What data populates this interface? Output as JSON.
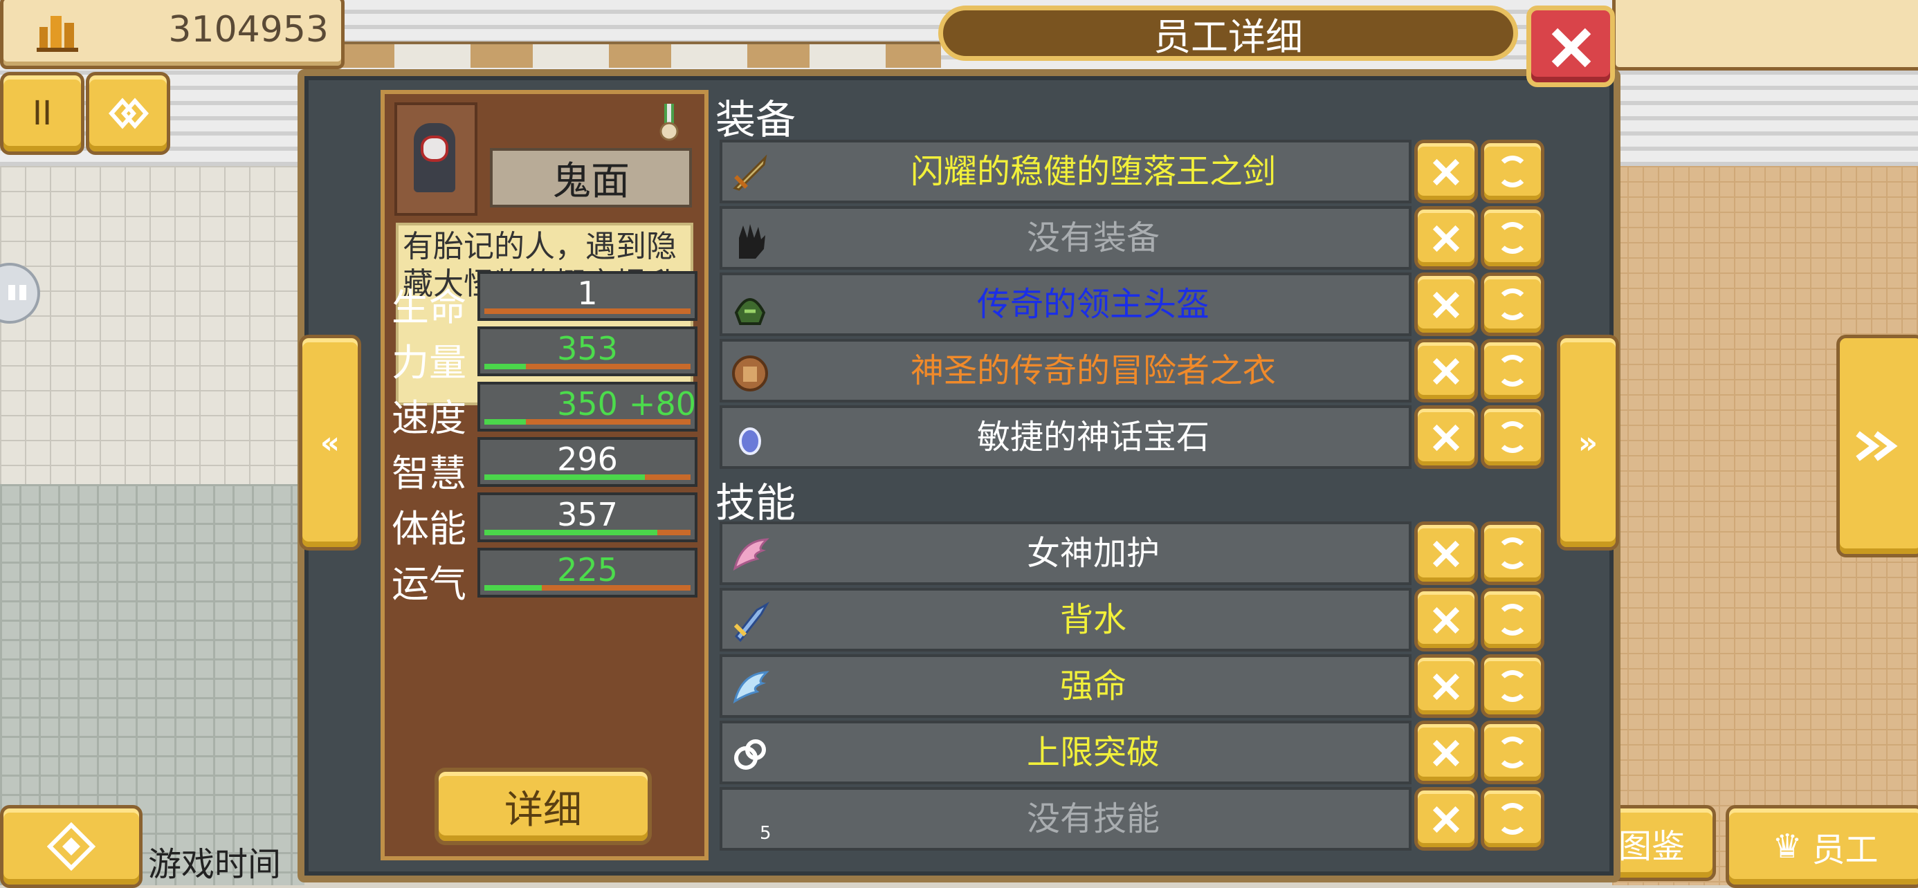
{
  "hud": {
    "money": "3104953",
    "pause_label": "II",
    "time_label": "游戏时间",
    "codex_label": "图鉴",
    "staff_label": "员工"
  },
  "dialog": {
    "title": "员工详细",
    "prev_arrow": "«",
    "next_arrow": "»"
  },
  "employee": {
    "name": "鬼面",
    "description": "有胎记的人，遇到隐藏大怪物的概率提升",
    "detail_button": "详细",
    "stats": [
      {
        "label": "生命",
        "value": "1",
        "bonus": "",
        "fill": 0.0,
        "color": "#ffffff"
      },
      {
        "label": "力量",
        "value": "353",
        "bonus": "",
        "fill": 0.2,
        "color": "#4cdc4c"
      },
      {
        "label": "速度",
        "value": "350",
        "bonus": "+80",
        "fill": 0.2,
        "color": "#4cdc4c"
      },
      {
        "label": "智慧",
        "value": "296",
        "bonus": "",
        "fill": 0.78,
        "color": "#ffffff"
      },
      {
        "label": "体能",
        "value": "357",
        "bonus": "",
        "fill": 0.84,
        "color": "#ffffff"
      },
      {
        "label": "运气",
        "value": "225",
        "bonus": "",
        "fill": 0.28,
        "color": "#4cdc4c"
      }
    ]
  },
  "equipment": {
    "title": "装备",
    "items": [
      {
        "name": "闪耀的稳健的堕落王之剑",
        "color": "#f2f03a",
        "icon": "sword-icon"
      },
      {
        "name": "没有装备",
        "color": "#a9adb0",
        "icon": "glove-icon"
      },
      {
        "name": "传奇的领主头盔",
        "color": "#1a2ee8",
        "icon": "helmet-icon"
      },
      {
        "name": "神圣的传奇的冒险者之衣",
        "color": "#f08a2a",
        "icon": "armor-icon"
      },
      {
        "name": "敏捷的神话宝石",
        "color": "#ffffff",
        "icon": "gem-icon"
      }
    ]
  },
  "skills": {
    "title": "技能",
    "items": [
      {
        "name": "女神加护",
        "color": "#ffffff",
        "icon": "wing-pink-icon"
      },
      {
        "name": "背水",
        "color": "#f2f03a",
        "icon": "blade-icon"
      },
      {
        "name": "强命",
        "color": "#f2f03a",
        "icon": "wing-blue-icon"
      },
      {
        "name": "上限突破",
        "color": "#f2f03a",
        "icon": "chain-icon"
      },
      {
        "name": "没有技能",
        "color": "#a9adb0",
        "icon": "empty-skill-icon",
        "slot": "5"
      }
    ]
  }
}
